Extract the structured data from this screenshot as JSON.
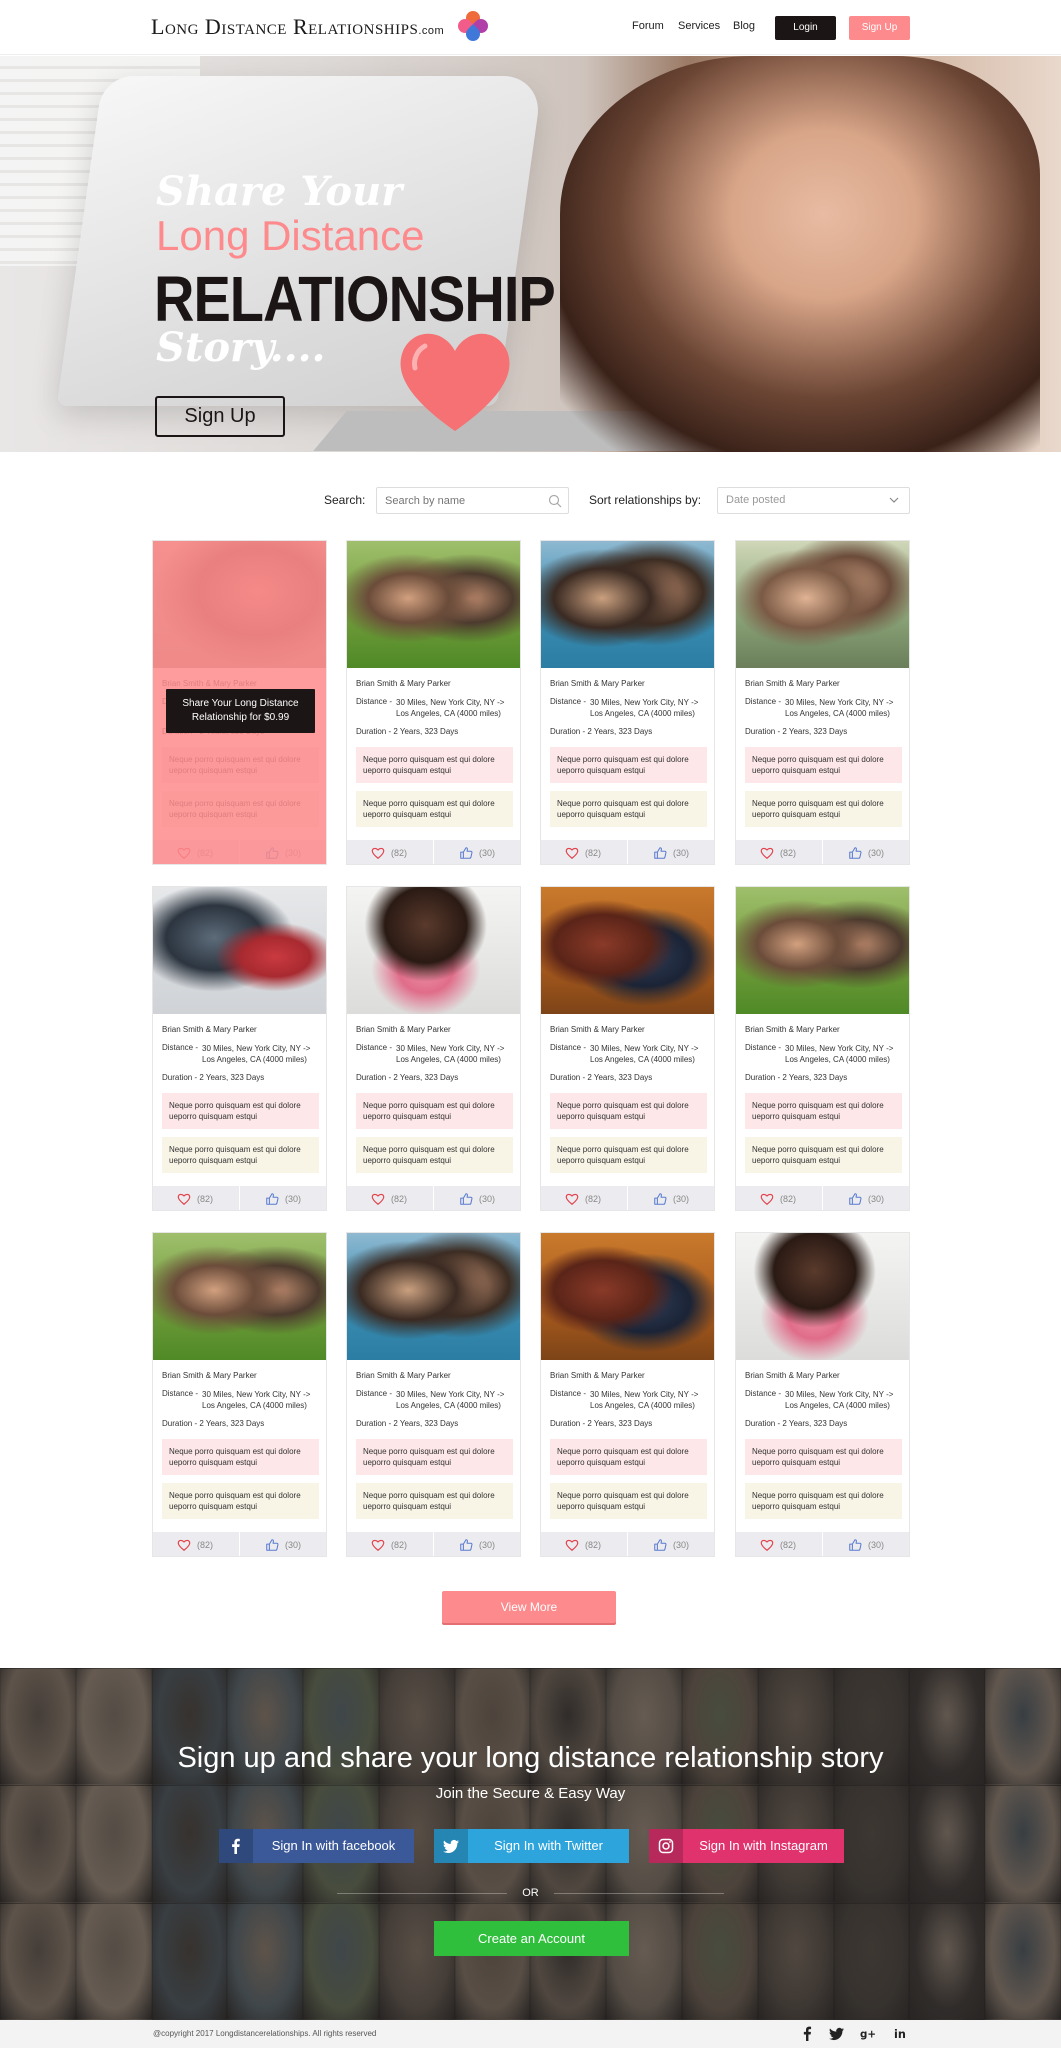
{
  "header": {
    "logo_text": "Long Distance Relationships",
    "logo_suffix": ".com",
    "nav": [
      "Forum",
      "Services",
      "Blog"
    ],
    "login": "Login",
    "signup": "Sign Up"
  },
  "hero": {
    "line1": "Share Your",
    "line2": "Long Distance",
    "line3": "RELATIONSHIP",
    "line4": "Story....",
    "button": "Sign Up"
  },
  "filters": {
    "search_label": "Search:",
    "search_placeholder": "Search by name",
    "sort_label": "Sort relationships by:",
    "sort_value": "Date posted"
  },
  "featured_overlay": {
    "names": "Brian Smith & Mary Parker",
    "promo_line1": "Share Your Long Distance",
    "promo_line2": "Relationship for $0.99"
  },
  "cards": [
    {
      "names": "Brian Smith & Mary Parker",
      "distance_label": "Distance -",
      "distance": "30 Miles, New York City, NY -> Los Angeles, CA (4000 miles)",
      "duration": "Duration -  2 Years, 323 Days",
      "quote1": "Neque porro quisquam est qui dolore ueporro quisquam estqui",
      "quote2": "Neque porro quisquam est qui dolore ueporro quisquam estqui",
      "likes": "(82)",
      "thumbs": "(30)"
    },
    {
      "names": "Brian Smith & Mary Parker",
      "distance_label": "Distance -",
      "distance": "30 Miles, New York City, NY -> Los Angeles, CA (4000 miles)",
      "duration": "Duration -  2 Years, 323 Days",
      "quote1": "Neque porro quisquam est qui dolore ueporro quisquam estqui",
      "quote2": "Neque porro quisquam est qui dolore ueporro quisquam estqui",
      "likes": "(82)",
      "thumbs": "(30)"
    },
    {
      "names": "Brian Smith & Mary Parker",
      "distance_label": "Distance -",
      "distance": "30 Miles, New York City, NY -> Los Angeles, CA (4000 miles)",
      "duration": "Duration -  2 Years, 323 Days",
      "quote1": "Neque porro quisquam est qui dolore ueporro quisquam estqui",
      "quote2": "Neque porro quisquam est qui dolore ueporro quisquam estqui",
      "likes": "(82)",
      "thumbs": "(30)"
    },
    {
      "names": "Brian Smith & Mary Parker",
      "distance_label": "Distance -",
      "distance": "30 Miles, New York City, NY -> Los Angeles, CA (4000 miles)",
      "duration": "Duration -  2 Years, 323 Days",
      "quote1": "Neque porro quisquam est qui dolore ueporro quisquam estqui",
      "quote2": "Neque porro quisquam est qui dolore ueporro quisquam estqui",
      "likes": "(82)",
      "thumbs": "(30)"
    },
    {
      "names": "Brian Smith & Mary Parker",
      "distance_label": "Distance -",
      "distance": "30 Miles, New York City, NY -> Los Angeles, CA (4000 miles)",
      "duration": "Duration -  2 Years, 323 Days",
      "quote1": "Neque porro quisquam est qui dolore ueporro quisquam estqui",
      "quote2": "Neque porro quisquam est qui dolore ueporro quisquam estqui",
      "likes": "(82)",
      "thumbs": "(30)"
    },
    {
      "names": "Brian Smith & Mary Parker",
      "distance_label": "Distance -",
      "distance": "30 Miles, New York City, NY -> Los Angeles, CA (4000 miles)",
      "duration": "Duration -  2 Years, 323 Days",
      "quote1": "Neque porro quisquam est qui dolore ueporro quisquam estqui",
      "quote2": "Neque porro quisquam est qui dolore ueporro quisquam estqui",
      "likes": "(82)",
      "thumbs": "(30)"
    },
    {
      "names": "Brian Smith & Mary Parker",
      "distance_label": "Distance -",
      "distance": "30 Miles, New York City, NY -> Los Angeles, CA (4000 miles)",
      "duration": "Duration -  2 Years, 323 Days",
      "quote1": "Neque porro quisquam est qui dolore ueporro quisquam estqui",
      "quote2": "Neque porro quisquam est qui dolore ueporro quisquam estqui",
      "likes": "(82)",
      "thumbs": "(30)"
    },
    {
      "names": "Brian Smith & Mary Parker",
      "distance_label": "Distance -",
      "distance": "30 Miles, New York City, NY -> Los Angeles, CA (4000 miles)",
      "duration": "Duration -  2 Years, 323 Days",
      "quote1": "Neque porro quisquam est qui dolore ueporro quisquam estqui",
      "quote2": "Neque porro quisquam est qui dolore ueporro quisquam estqui",
      "likes": "(82)",
      "thumbs": "(30)"
    },
    {
      "names": "Brian Smith & Mary Parker",
      "distance_label": "Distance -",
      "distance": "30 Miles, New York City, NY -> Los Angeles, CA (4000 miles)",
      "duration": "Duration -  2 Years, 323 Days",
      "quote1": "Neque porro quisquam est qui dolore ueporro quisquam estqui",
      "quote2": "Neque porro quisquam est qui dolore ueporro quisquam estqui",
      "likes": "(82)",
      "thumbs": "(30)"
    },
    {
      "names": "Brian Smith & Mary Parker",
      "distance_label": "Distance -",
      "distance": "30 Miles, New York City, NY -> Los Angeles, CA (4000 miles)",
      "duration": "Duration -  2 Years, 323 Days",
      "quote1": "Neque porro quisquam est qui dolore ueporro quisquam estqui",
      "quote2": "Neque porro quisquam est qui dolore ueporro quisquam estqui",
      "likes": "(82)",
      "thumbs": "(30)"
    },
    {
      "names": "Brian Smith & Mary Parker",
      "distance_label": "Distance -",
      "distance": "30 Miles, New York City, NY -> Los Angeles, CA (4000 miles)",
      "duration": "Duration -  2 Years, 323 Days",
      "quote1": "Neque porro quisquam est qui dolore ueporro quisquam estqui",
      "quote2": "Neque porro quisquam est qui dolore ueporro quisquam estqui",
      "likes": "(82)",
      "thumbs": "(30)"
    },
    {
      "names": "Brian Smith & Mary Parker",
      "distance_label": "Distance -",
      "distance": "30 Miles, New York City, NY -> Los Angeles, CA (4000 miles)",
      "duration": "Duration -  2 Years, 323 Days",
      "quote1": "Neque porro quisquam est qui dolore ueporro quisquam estqui",
      "quote2": "Neque porro quisquam est qui dolore ueporro quisquam estqui",
      "likes": "(82)",
      "thumbs": "(30)"
    }
  ],
  "view_more": "View More",
  "cta": {
    "title": "Sign up and share your long distance relationship story",
    "subtitle": "Join the Secure & Easy Way",
    "facebook": "Sign In with facebook",
    "twitter": "Sign In with Twitter",
    "instagram": "Sign In with Instagram",
    "or": "OR",
    "create": "Create an Account"
  },
  "footer": {
    "copyright": "@copyright 2017 Longdistancerelationships. All rights reserved"
  },
  "colors": {
    "accent": "#fd8a8c",
    "dark": "#1c1516",
    "facebook": "#3b5998",
    "twitter": "#2ea4dc",
    "instagram": "#e0336e",
    "create": "#2fbf3c"
  }
}
